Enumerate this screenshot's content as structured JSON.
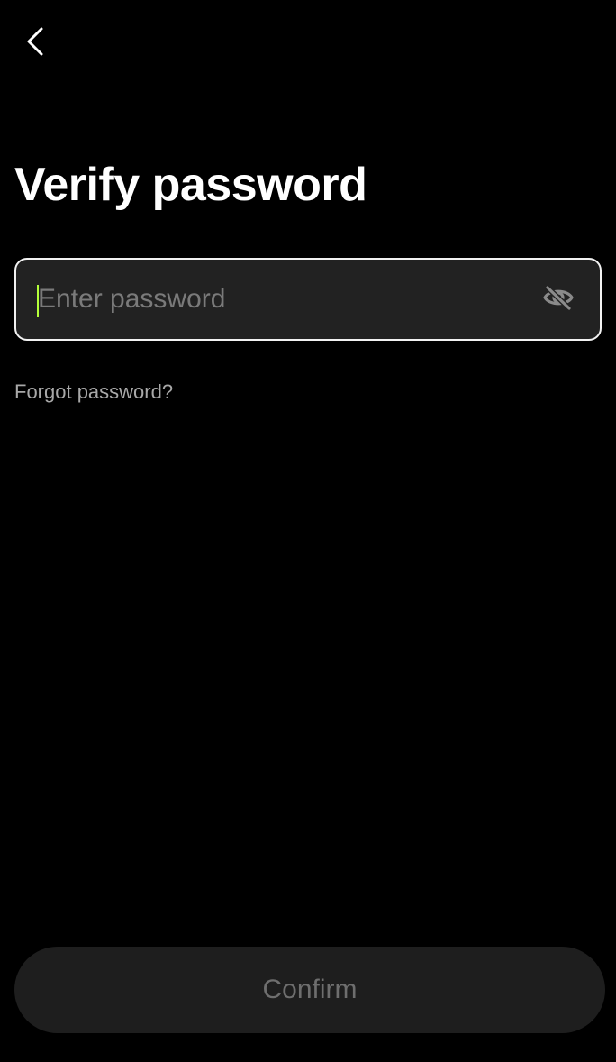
{
  "header": {
    "back_icon": "chevron-left-icon"
  },
  "page": {
    "title": "Verify password"
  },
  "password_field": {
    "value": "",
    "placeholder": "Enter password",
    "toggle_icon": "eye-off-icon",
    "caret_color": "#b4ff39"
  },
  "links": {
    "forgot_password": "Forgot password?"
  },
  "footer": {
    "confirm_label": "Confirm",
    "confirm_enabled": false
  },
  "colors": {
    "background": "#000000",
    "field_background": "#222222",
    "field_border": "#f2f2f2",
    "accent": "#b4ff39",
    "button_background": "#1e1e1e",
    "button_text_disabled": "#6e6e6e"
  }
}
